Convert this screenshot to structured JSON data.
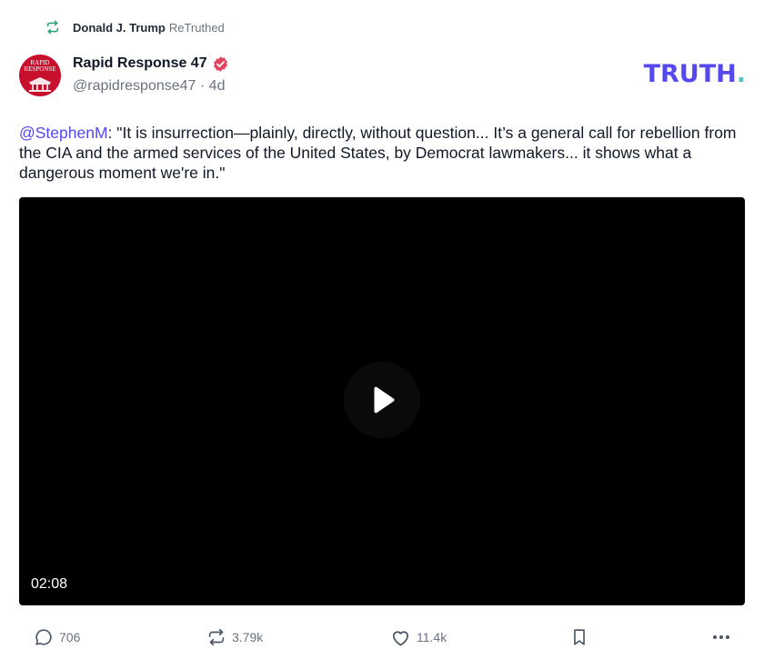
{
  "retruth": {
    "icon": "retruth-icon",
    "name": "Donald J. Trump",
    "label": "ReTruthed",
    "color": "#22a06b"
  },
  "author": {
    "display_name": "Rapid Response 47",
    "handle": "@rapidresponse47",
    "separator": "·",
    "age": "4d",
    "avatar_text": "RAPID RESPONSE",
    "verified_icon": "verified-badge-icon",
    "verified_color": "#e0445f"
  },
  "brand": {
    "logo_text": "TRUTH",
    "logo_dot": ".",
    "logo_color": "#5448ee",
    "dot_color": "#5bc0be"
  },
  "post": {
    "mention": "@StephenM",
    "body": ": \"It is insurrection—plainly, directly, without question... It’s a general call for rebellion from the CIA and the armed services of the United States, by Democrat lawmakers... it shows what a dangerous moment we're in.\""
  },
  "video": {
    "play_icon": "play-icon",
    "duration": "02:08"
  },
  "actions": {
    "replies": "706",
    "retruths": "3.79k",
    "likes": "11.4k",
    "reply_icon": "comment-icon",
    "retruth_icon": "retruth-icon",
    "like_icon": "heart-icon",
    "bookmark_icon": "bookmark-icon",
    "more_icon": "more-icon"
  }
}
